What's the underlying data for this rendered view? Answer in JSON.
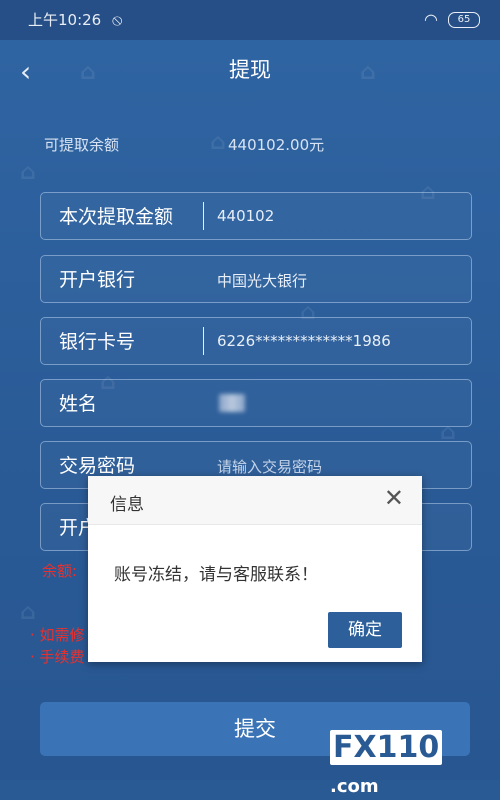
{
  "status_bar": {
    "time": "上午10:26",
    "battery": "65"
  },
  "header": {
    "title": "提现"
  },
  "balance": {
    "label": "可提取余额",
    "value": "440102.00元"
  },
  "form": {
    "amount": {
      "label": "本次提取金额",
      "value": "440102"
    },
    "bank": {
      "label": "开户银行",
      "value": "中国光大银行"
    },
    "card": {
      "label": "银行卡号",
      "value": "6226*************1986"
    },
    "name": {
      "label": "姓名",
      "value": ""
    },
    "password": {
      "label": "交易密码",
      "placeholder": "请输入交易密码"
    },
    "branch": {
      "label": "开户"
    }
  },
  "notes": {
    "balance_prefix": "余额:",
    "note1": "· 如需修",
    "note2": "· 手续费"
  },
  "submit_label": "提交",
  "dialog": {
    "title": "信息",
    "close": "✕",
    "message": "账号冻结，请与客服联系！",
    "ok_label": "确定"
  },
  "logo": {
    "brand": "FX110",
    "suffix": ".com"
  },
  "colors": {
    "page_bg": "#2a5a94",
    "accent": "#2d5f9a",
    "warning": "#e8312e"
  }
}
